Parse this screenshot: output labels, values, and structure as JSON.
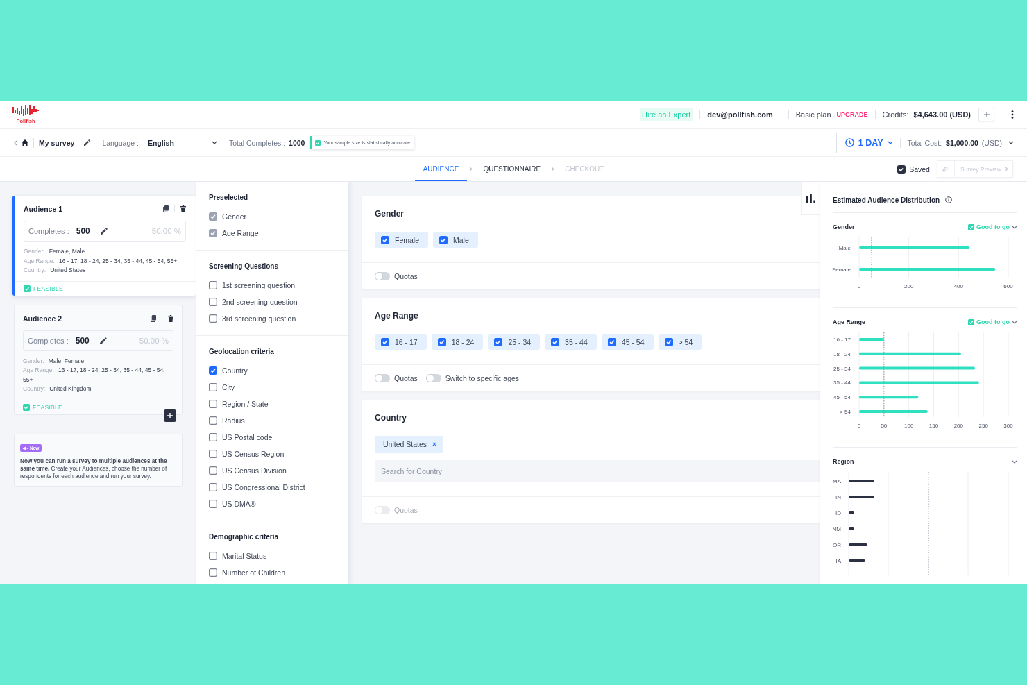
{
  "logo": {
    "name": "Pollfish"
  },
  "account": {
    "hire_expert": "Hire an Expert",
    "email": "dev@pollfish.com",
    "plan": "Basic plan",
    "upgrade": "UPGRADE",
    "credits_label": "Credits:",
    "credits": "$4,643.00 (USD)"
  },
  "survey_bar": {
    "title": "My survey",
    "language_label": "Language :",
    "language": "English",
    "completes_label": "Total Completes :",
    "completes": "1000",
    "accuracy_note": "Your sample size is statistically accurate",
    "duration": "1 DAY",
    "cost_label": "Total Cost:",
    "cost": "$1,000.00",
    "currency": "(USD)"
  },
  "steps": [
    {
      "label": "AUDIENCE",
      "selected": true,
      "disabled": false
    },
    {
      "label": "QUESTIONNAIRE",
      "selected": false,
      "disabled": false
    },
    {
      "label": "CHECKOUT",
      "selected": false,
      "disabled": true
    }
  ],
  "saved": {
    "label": "Saved",
    "checked": true
  },
  "preview": {
    "label": "Survey Preview",
    "disabled": true
  },
  "audiences": [
    {
      "name": "Audience 1",
      "selected": true,
      "completes_label": "Completes :",
      "completes": "500",
      "share": "50.00 %",
      "details": [
        {
          "label": "Gender:",
          "value": "Female, Male"
        },
        {
          "label": "Age Range:",
          "value": "16 - 17, 18 - 24, 25 - 34, 35 - 44, 45 - 54, 55+"
        },
        {
          "label": "Country:",
          "value": "United States"
        }
      ],
      "status": "FEASIBLE",
      "feasible": true
    },
    {
      "name": "Audience 2",
      "selected": false,
      "completes_label": "Completes :",
      "completes": "500",
      "share": "50.00 %",
      "details": [
        {
          "label": "Gender:",
          "value": "Male, Female"
        },
        {
          "label": "Age Range:",
          "value": "16 - 17, 18 - 24, 25 - 34, 35 - 44, 45 - 54, 55+"
        },
        {
          "label": "Country:",
          "value": "United Kingdom"
        }
      ],
      "status": "FEASIBLE",
      "feasible": true
    }
  ],
  "notice": {
    "badge": "New",
    "text": "**Now you can run a survey to multiple audiences at the same time.** Create your Audiences, choose the number of respondents for each audience and run your survey."
  },
  "criteria": [
    {
      "title": "Preselected",
      "items": [
        {
          "label": "Gender",
          "checked": true,
          "disabled": true
        },
        {
          "label": "Age Range",
          "checked": true,
          "disabled": true
        }
      ]
    },
    {
      "title": "Screening Questions",
      "items": [
        {
          "label": "1st screening question",
          "checked": false,
          "disabled": false
        },
        {
          "label": "2nd screening question",
          "checked": false,
          "disabled": false
        },
        {
          "label": "3rd screening question",
          "checked": false,
          "disabled": false
        }
      ]
    },
    {
      "title": "Geolocation criteria",
      "items": [
        {
          "label": "Country",
          "checked": true,
          "disabled": false
        },
        {
          "label": "City",
          "checked": false,
          "disabled": false
        },
        {
          "label": "Region / State",
          "checked": false,
          "disabled": false
        },
        {
          "label": "Radius",
          "checked": false,
          "disabled": false
        },
        {
          "label": "US Postal code",
          "checked": false,
          "disabled": false
        },
        {
          "label": "US Census Region",
          "checked": false,
          "disabled": false
        },
        {
          "label": "US Census Division",
          "checked": false,
          "disabled": false
        },
        {
          "label": "US Congressional District",
          "checked": false,
          "disabled": false
        },
        {
          "label": "US DMA®",
          "checked": false,
          "disabled": false
        }
      ]
    },
    {
      "title": "Demographic criteria",
      "items": [
        {
          "label": "Marital Status",
          "checked": false,
          "disabled": false
        },
        {
          "label": "Number of Children",
          "checked": false,
          "disabled": false
        }
      ]
    }
  ],
  "targeting": [
    {
      "kind": "options",
      "title": "Gender",
      "options": [
        {
          "label": "Female",
          "checked": true
        },
        {
          "label": "Male",
          "checked": true
        }
      ],
      "toggles": [
        {
          "label": "Quotas",
          "on": false,
          "disabled": false
        }
      ]
    },
    {
      "kind": "options",
      "title": "Age Range",
      "options": [
        {
          "label": "16 - 17",
          "checked": true
        },
        {
          "label": "18 - 24",
          "checked": true
        },
        {
          "label": "25 - 34",
          "checked": true
        },
        {
          "label": "35 - 44",
          "checked": true
        },
        {
          "label": "45 - 54",
          "checked": true
        },
        {
          "label": "> 54",
          "checked": true
        }
      ],
      "toggles": [
        {
          "label": "Quotas",
          "on": false,
          "disabled": false
        },
        {
          "label": "Switch to specific ages",
          "on": false,
          "disabled": false
        }
      ]
    },
    {
      "kind": "tags",
      "title": "Country",
      "tags": [
        "United States"
      ],
      "search": {
        "placeholder": "Search for Country"
      },
      "toggles": [
        {
          "label": "Quotas",
          "on": false,
          "disabled": true
        }
      ]
    }
  ],
  "distribution": {
    "title": "Estimated Audience Distribution",
    "sections": [
      {
        "kind": "chart",
        "title": "Gender",
        "status": "Good to go",
        "chart_data": {
          "type": "bar",
          "orientation": "horizontal",
          "categories": [
            "Male",
            "Female"
          ],
          "values": [
            445,
            548
          ],
          "xlim": [
            0,
            600
          ],
          "xticks": [
            0,
            200,
            400,
            600
          ],
          "grid": true,
          "ref_lines": [
            {
              "axis": "x",
              "value": 50
            }
          ]
        }
      },
      {
        "kind": "chart",
        "title": "Age Range",
        "status": "Good to go",
        "chart_data": {
          "type": "bar",
          "orientation": "horizontal",
          "categories": [
            "16 - 17",
            "18 - 24",
            "25 - 34",
            "35 - 44",
            "45 - 54",
            "> 54"
          ],
          "values": [
            50,
            205,
            233,
            241,
            119,
            138
          ],
          "xlim": [
            0,
            300
          ],
          "xticks": [
            0,
            50,
            100,
            150,
            200,
            250,
            300
          ],
          "grid": true,
          "ref_lines": [
            {
              "axis": "x",
              "value": 50
            }
          ]
        }
      },
      {
        "kind": "picture",
        "title": "Region",
        "labels": [
          "MA",
          "IN",
          "ID",
          "NM",
          "OR",
          "IA"
        ]
      }
    ]
  }
}
